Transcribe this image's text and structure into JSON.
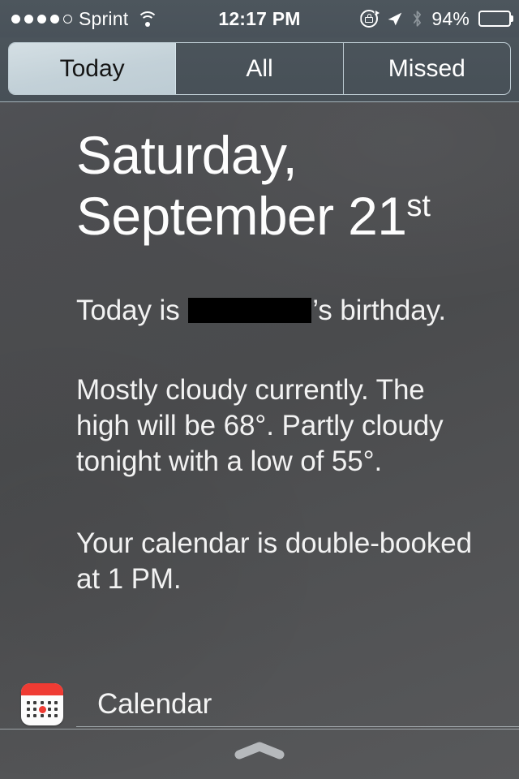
{
  "status_bar": {
    "signal_dots_filled": 4,
    "signal_dots_total": 5,
    "carrier": "Sprint",
    "wifi_icon": "wifi-icon",
    "time": "12:17 PM",
    "rotation_lock_icon": "rotation-lock-icon",
    "location_icon": "location-arrow-icon",
    "bluetooth_icon": "bluetooth-icon",
    "battery_percent": "94%",
    "battery_level": 92
  },
  "segmented_control": {
    "segments": [
      {
        "label": "Today",
        "selected": true
      },
      {
        "label": "All",
        "selected": false
      },
      {
        "label": "Missed",
        "selected": false
      }
    ]
  },
  "today_view": {
    "headline_line1": "Saturday,",
    "headline_line2": "September 21",
    "headline_ordinal": "st",
    "birthday": {
      "prefix": "Today is ",
      "redacted_name": "",
      "suffix": "’s birthday."
    },
    "weather_summary": "Mostly cloudy currently. The high will be 68°. Partly cloudy tonight with a low of 55°.",
    "calendar_summary": "Your calendar is double-booked at 1 PM."
  },
  "app_section": {
    "icon": "calendar-app-icon",
    "name": "Calendar"
  },
  "grabber": {
    "icon": "grabber-chevron-icon"
  },
  "colors": {
    "accent_red": "#ef3b33",
    "selected_segment": "#c3d1d8",
    "background": "#4b4b4d",
    "header_bar": "#49525a",
    "text_primary": "#ffffff",
    "grabber": "#b6b9bc"
  }
}
